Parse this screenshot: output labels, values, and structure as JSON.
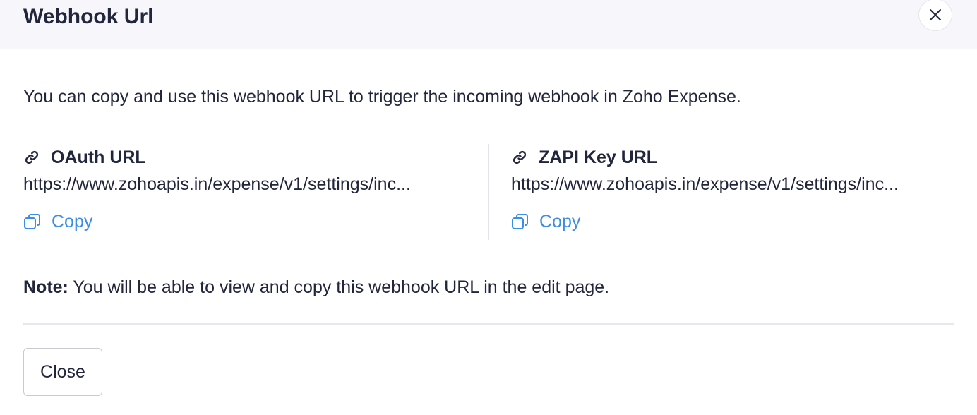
{
  "dialog": {
    "title": "Webhook Url",
    "close_icon": "close-icon"
  },
  "description": "You can copy and use this webhook URL to trigger the incoming webhook in Zoho Expense.",
  "urls": [
    {
      "icon": "link-icon",
      "label": "OAuth URL",
      "value": "https://www.zohoapis.in/expense/v1/settings/inc...",
      "copy_icon": "copy-icon",
      "copy_label": "Copy"
    },
    {
      "icon": "link-icon",
      "label": "ZAPI Key URL",
      "value": "https://www.zohoapis.in/expense/v1/settings/inc...",
      "copy_icon": "copy-icon",
      "copy_label": "Copy"
    }
  ],
  "note": {
    "prefix": "Note:",
    "text": " You will be able to view and copy this webhook URL in the edit page."
  },
  "footer": {
    "close_label": "Close"
  },
  "colors": {
    "accent": "#3b8de8",
    "text": "#21263c",
    "header_bg": "#f7f7fb"
  }
}
